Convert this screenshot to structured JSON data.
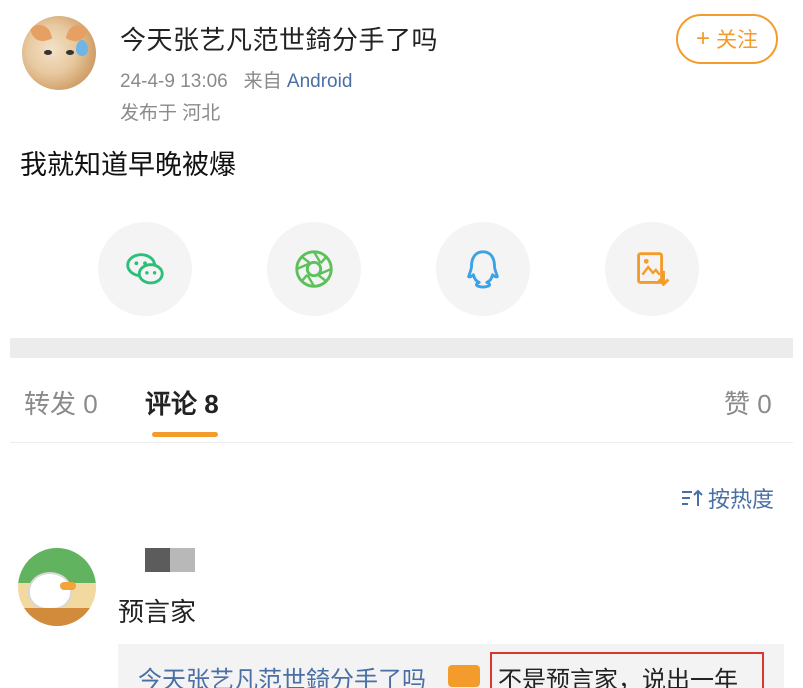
{
  "post": {
    "author": "今天张艺凡范世錡分手了吗",
    "date": "24-4-9 13:06",
    "from_label": "来自",
    "source": "Android",
    "location": "发布于 河北",
    "body": "我就知道早晚被爆",
    "follow_plus": "+",
    "follow_label": "关注"
  },
  "share": {
    "items": [
      {
        "icon": "wechat-icon",
        "color": "#2bbf79"
      },
      {
        "icon": "moments-icon",
        "color": "#5cc15a"
      },
      {
        "icon": "qq-icon",
        "color": "#3ba2e6"
      },
      {
        "icon": "save-image-icon",
        "color": "#f39b2b"
      }
    ]
  },
  "tabs": {
    "repost": "转发 0",
    "comments": "评论 8",
    "likes": "赞 0"
  },
  "sort_label": "按热度",
  "comment": {
    "name": "预言家",
    "reply_author": "今天张艺凡范世錡分手了吗",
    "reply_text": "不是预言家，说出一年"
  },
  "colors": {
    "accent": "#f39b2b",
    "link": "#4a6fa5",
    "highlight_border": "#d9372f"
  }
}
